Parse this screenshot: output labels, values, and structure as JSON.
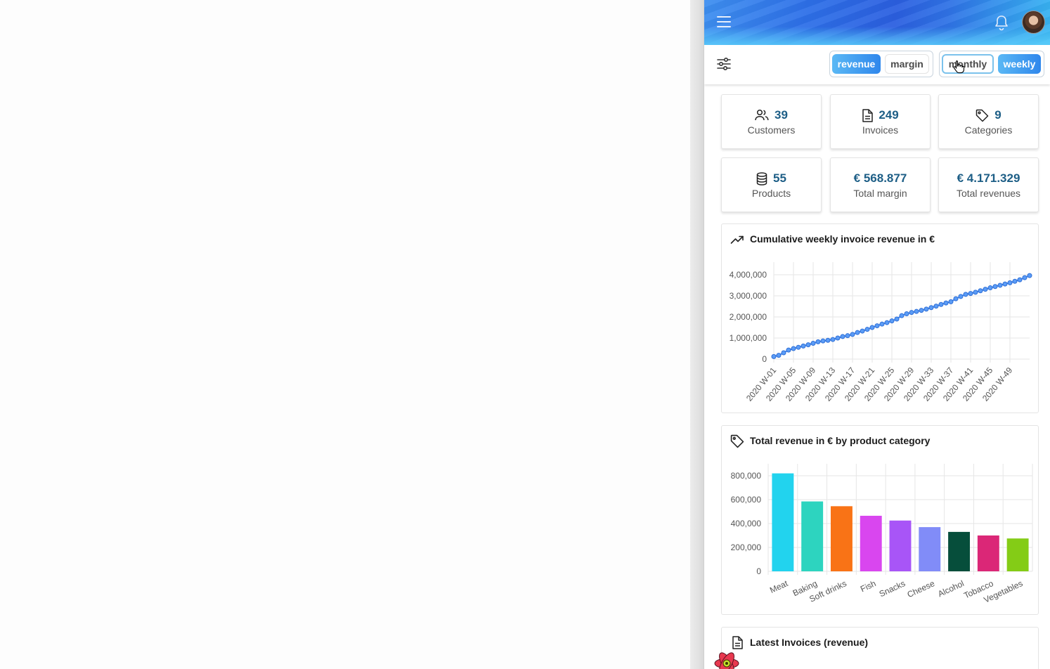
{
  "toggles": {
    "metric": [
      {
        "label": "revenue",
        "active": true
      },
      {
        "label": "margin",
        "active": false
      }
    ],
    "period": [
      {
        "label": "monthly",
        "active": false
      },
      {
        "label": "weekly",
        "active": true
      }
    ]
  },
  "stats": [
    {
      "icon": "users-icon",
      "value": "39",
      "label": "Customers"
    },
    {
      "icon": "document-icon",
      "value": "249",
      "label": "Invoices"
    },
    {
      "icon": "tag-icon",
      "value": "9",
      "label": "Categories"
    },
    {
      "icon": "database-icon",
      "value": "55",
      "label": "Products"
    },
    {
      "icon": "",
      "value": "€ 568.877",
      "label": "Total margin"
    },
    {
      "icon": "",
      "value": "€ 4.171.329",
      "label": "Total revenues"
    }
  ],
  "line_panel": {
    "title": "Cumulative weekly invoice revenue in €",
    "icon": "trending-up-icon"
  },
  "bar_panel": {
    "title": "Total revenue in € by product category",
    "icon": "tag-icon"
  },
  "invoices_panel": {
    "title": "Latest Invoices (revenue)",
    "icon": "document-icon"
  },
  "colors": {
    "accent": "#2f87ec",
    "line": "#3b82f6",
    "stat_value": "#1d5e86"
  },
  "chart_data": [
    {
      "type": "line",
      "title": "Cumulative weekly invoice revenue in €",
      "x_tick_labels": [
        "2020 W-01",
        "2020 W-05",
        "2020 W-09",
        "2020 W-13",
        "2020 W-17",
        "2020 W-21",
        "2020 W-25",
        "2020 W-29",
        "2020 W-33",
        "2020 W-37",
        "2020 W-41",
        "2020 W-45",
        "2020 W-49"
      ],
      "y_tick_labels": [
        "0",
        "1,000,000",
        "2,000,000",
        "3,000,000",
        "4,000,000"
      ],
      "ylim": [
        0,
        4000000
      ],
      "grid": true,
      "series": [
        {
          "x": [
            "2020 W-01",
            "2020 W-02",
            "2020 W-03",
            "2020 W-04",
            "2020 W-05",
            "2020 W-06",
            "2020 W-07",
            "2020 W-08",
            "2020 W-09",
            "2020 W-10",
            "2020 W-11",
            "2020 W-12",
            "2020 W-13",
            "2020 W-14",
            "2020 W-15",
            "2020 W-16",
            "2020 W-17",
            "2020 W-18",
            "2020 W-19",
            "2020 W-20",
            "2020 W-21",
            "2020 W-22",
            "2020 W-23",
            "2020 W-24",
            "2020 W-25",
            "2020 W-26",
            "2020 W-27",
            "2020 W-28",
            "2020 W-29",
            "2020 W-30",
            "2020 W-31",
            "2020 W-32",
            "2020 W-33",
            "2020 W-34",
            "2020 W-35",
            "2020 W-36",
            "2020 W-37",
            "2020 W-38",
            "2020 W-39",
            "2020 W-40",
            "2020 W-41",
            "2020 W-42",
            "2020 W-43",
            "2020 W-44",
            "2020 W-45",
            "2020 W-46",
            "2020 W-47",
            "2020 W-48",
            "2020 W-49",
            "2020 W-50",
            "2020 W-51",
            "2020 W-52",
            "2020 W-53"
          ],
          "values": [
            120000,
            180000,
            300000,
            430000,
            500000,
            560000,
            620000,
            680000,
            750000,
            820000,
            860000,
            890000,
            930000,
            1000000,
            1070000,
            1110000,
            1170000,
            1260000,
            1330000,
            1410000,
            1500000,
            1580000,
            1660000,
            1730000,
            1810000,
            1900000,
            2060000,
            2150000,
            2210000,
            2260000,
            2310000,
            2370000,
            2440000,
            2510000,
            2590000,
            2660000,
            2720000,
            2860000,
            2970000,
            3070000,
            3110000,
            3170000,
            3240000,
            3310000,
            3380000,
            3440000,
            3500000,
            3560000,
            3620000,
            3690000,
            3760000,
            3860000,
            3960000
          ]
        }
      ]
    },
    {
      "type": "bar",
      "title": "Total revenue in € by product category",
      "categories": [
        "Meat",
        "Baking",
        "Soft drinks",
        "Fish",
        "Snacks",
        "Cheese",
        "Alcohol",
        "Tobacco",
        "Vegetables"
      ],
      "values": [
        820000,
        585000,
        545000,
        465000,
        425000,
        370000,
        330000,
        300000,
        275000
      ],
      "colors": [
        "#22d3ee",
        "#2dd4bf",
        "#f97316",
        "#d946ef",
        "#a855f7",
        "#818cf8",
        "#064e3b",
        "#db2777",
        "#84cc16"
      ],
      "y_tick_labels": [
        "0",
        "200,000",
        "400,000",
        "600,000",
        "800,000"
      ],
      "ylim": [
        0,
        900000
      ],
      "grid": true
    }
  ]
}
